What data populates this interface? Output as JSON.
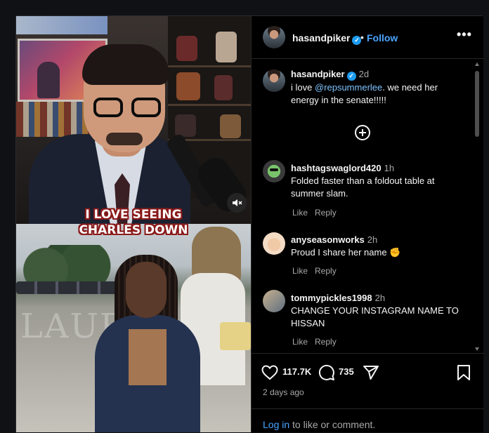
{
  "post": {
    "username": "hasandpiker",
    "follow_label": "Follow",
    "dot": "•",
    "more_label": "•••",
    "caption": {
      "username": "hasandpiker",
      "time": "2d",
      "text_before": "i love ",
      "mention": "@repsummerlee",
      "text_after": ". we need her energy in the senate!!!!!"
    }
  },
  "media": {
    "overlay_caption_line1": "I LOVE SEEING",
    "overlay_caption_line2": "CHARLES DOWN",
    "watermark": "LAURA LOO",
    "mute_icon": "speaker-muted-icon"
  },
  "comments": [
    {
      "username": "hashtagswaglord420",
      "time": "1h",
      "line1": "Folded faster than a foldout table at",
      "line2": "summer slam.",
      "like_label": "Like",
      "reply_label": "Reply"
    },
    {
      "username": "anyseasonworks",
      "time": "2h",
      "line1": "Proud I share her name",
      "emoji": "✊",
      "like_label": "Like",
      "reply_label": "Reply"
    },
    {
      "username": "tommypickles1998",
      "time": "2h",
      "line1": "CHANGE YOUR INSTAGRAM NAME TO",
      "line2": "HISSAN",
      "like_label": "Like",
      "reply_label": "Reply"
    }
  ],
  "actions": {
    "likes": "117.7K",
    "comments": "735",
    "posted": "2 days ago",
    "login_link": "Log in",
    "login_text": " to like or comment."
  },
  "colors": {
    "accent": "#4aa4ff",
    "verified": "#1d9bf0",
    "background": "#000000"
  }
}
